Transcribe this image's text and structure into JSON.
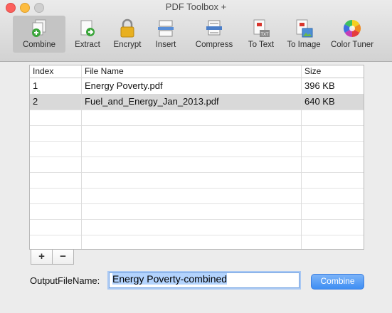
{
  "window": {
    "title": "PDF Toolbox +"
  },
  "toolbar": {
    "items": [
      {
        "label": "Combine",
        "icon": "combine-icon",
        "selected": true
      },
      {
        "label": "Extract",
        "icon": "extract-icon"
      },
      {
        "label": "Encrypt",
        "icon": "lock-icon"
      },
      {
        "label": "Insert",
        "icon": "insert-icon"
      },
      {
        "label": "Compress",
        "icon": "compress-icon"
      },
      {
        "label": "To Text",
        "icon": "to-text-icon"
      },
      {
        "label": "To Image",
        "icon": "to-image-icon"
      },
      {
        "label": "Color Tuner",
        "icon": "color-wheel-icon"
      }
    ]
  },
  "table": {
    "columns": [
      "Index",
      "File Name",
      "Size"
    ],
    "rows": [
      {
        "index": "1",
        "file": "Energy Poverty.pdf",
        "size": "396 KB"
      },
      {
        "index": "2",
        "file": "Fuel_and_Energy_Jan_2013.pdf",
        "size": "640 KB"
      }
    ]
  },
  "buttons": {
    "add": "+",
    "remove": "−",
    "combine": "Combine"
  },
  "output": {
    "label": "OutputFileName:",
    "value": "Energy Poverty-combined"
  },
  "colors": {
    "accent": "#3e8ef3",
    "selection": "#b3d3fd"
  }
}
